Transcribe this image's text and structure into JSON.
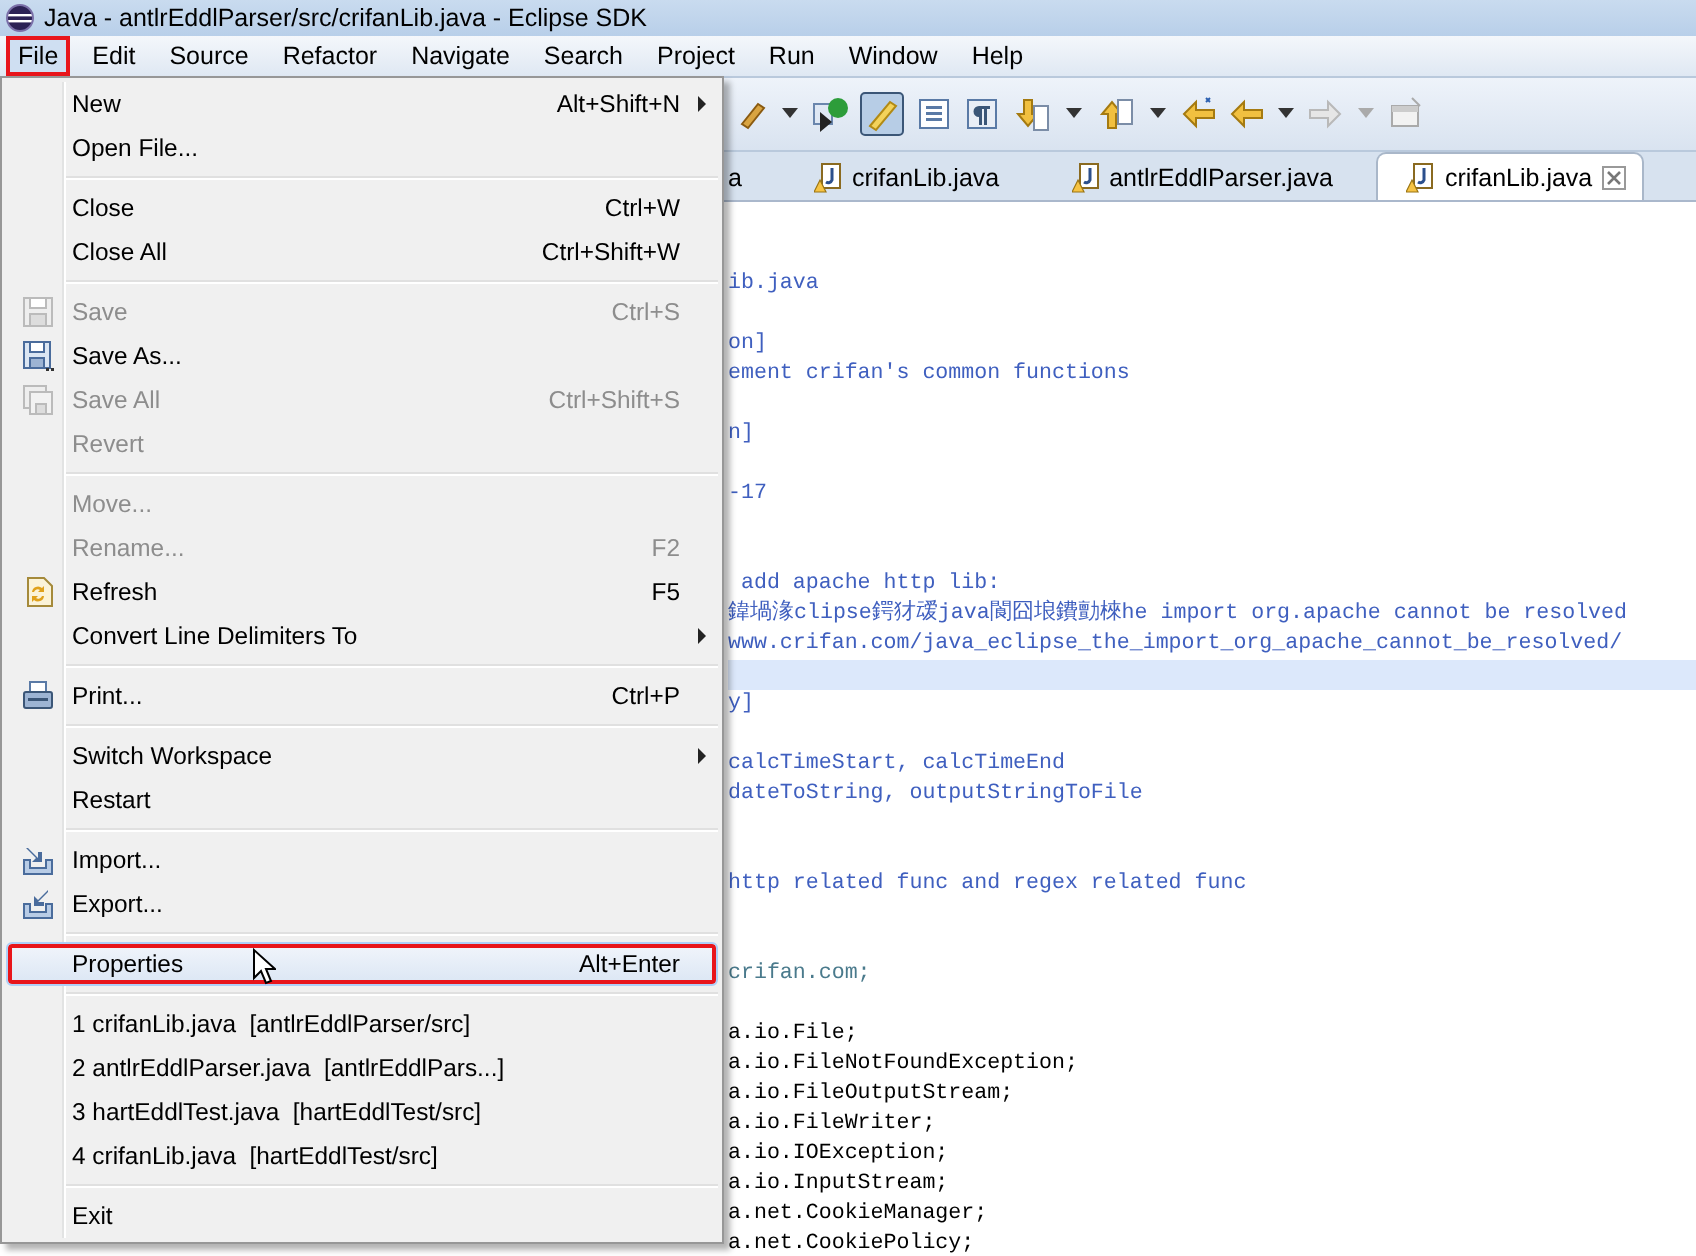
{
  "window": {
    "title": "Java - antlrEddlParser/src/crifanLib.java - Eclipse SDK"
  },
  "menubar": [
    {
      "label": "File",
      "selected": true,
      "highlighted": true
    },
    {
      "label": "Edit",
      "selected": false,
      "highlighted": false
    },
    {
      "label": "Source",
      "selected": false,
      "highlighted": false
    },
    {
      "label": "Refactor",
      "selected": false,
      "highlighted": false
    },
    {
      "label": "Navigate",
      "selected": false,
      "highlighted": false
    },
    {
      "label": "Search",
      "selected": false,
      "highlighted": false
    },
    {
      "label": "Project",
      "selected": false,
      "highlighted": false
    },
    {
      "label": "Run",
      "selected": false,
      "highlighted": false
    },
    {
      "label": "Window",
      "selected": false,
      "highlighted": false
    },
    {
      "label": "Help",
      "selected": false,
      "highlighted": false
    }
  ],
  "tabs": [
    {
      "label": "a",
      "selected": false,
      "warning": false,
      "closable": false
    },
    {
      "label": "crifanLib.java",
      "selected": false,
      "warning": true,
      "closable": false
    },
    {
      "label": "antlrEddlParser.java",
      "selected": false,
      "warning": true,
      "closable": false
    },
    {
      "label": "crifanLib.java",
      "selected": true,
      "warning": true,
      "closable": true
    }
  ],
  "editor": {
    "lines": [
      {
        "kind": "comment",
        "current": false
      },
      {
        "text": "ib.java",
        "kind": "comment",
        "current": false
      },
      {
        "kind": "comment",
        "current": false
      },
      {
        "text": "on]",
        "kind": "comment",
        "current": false
      },
      {
        "text": "ement crifan's common functions",
        "kind": "comment",
        "current": false
      },
      {
        "kind": "comment",
        "current": false
      },
      {
        "text": "n]",
        "kind": "comment",
        "current": false
      },
      {
        "kind": "comment",
        "current": false
      },
      {
        "text": "-17",
        "kind": "comment",
        "current": false
      },
      {
        "kind": "comment",
        "current": false
      },
      {
        "kind": "comment",
        "current": false
      },
      {
        "text": " add apache http lib:",
        "kind": "comment",
        "current": false
      },
      {
        "text": "鍏堝湪clipse鍔犲叆java閬囧埌鐨勯棶he import org.apache cannot be resolved",
        "kind": "comment",
        "current": false
      },
      {
        "text": "www.crifan.com/java_eclipse_the_import_org_apache_cannot_be_resolved/",
        "kind": "comment",
        "current": false
      },
      {
        "kind": "comment",
        "current": true
      },
      {
        "text": "y]",
        "kind": "comment",
        "current": false
      },
      {
        "kind": "comment",
        "current": false
      },
      {
        "text": "calcTimeStart, calcTimeEnd",
        "kind": "comment",
        "current": false
      },
      {
        "text": "dateToString, outputStringToFile",
        "kind": "comment",
        "current": false
      },
      {
        "kind": "comment",
        "current": false
      },
      {
        "kind": "comment",
        "current": false
      },
      {
        "text": "http related func and regex related func",
        "kind": "comment",
        "current": false
      },
      {
        "kind": "comment",
        "current": false
      },
      {
        "kind": "comment",
        "current": false
      },
      {
        "text": "crifan.com;",
        "kind": "package",
        "current": false
      },
      {
        "kind": "code",
        "current": false
      },
      {
        "text": "a.io.File;",
        "kind": "code",
        "current": false
      },
      {
        "text": "a.io.FileNotFoundException;",
        "kind": "code",
        "current": false
      },
      {
        "text": "a.io.FileOutputStream;",
        "kind": "code",
        "current": false
      },
      {
        "text": "a.io.FileWriter;",
        "kind": "code",
        "current": false
      },
      {
        "text": "a.io.IOException;",
        "kind": "code",
        "current": false
      },
      {
        "text": "a.io.InputStream;",
        "kind": "code",
        "current": false
      },
      {
        "text": "a.net.CookieManager;",
        "kind": "code",
        "current": false
      },
      {
        "text": "a.net.CookiePolicy;",
        "kind": "code",
        "current": false
      }
    ]
  },
  "file_menu": {
    "items": [
      {
        "kind": "item",
        "label": "New",
        "shortcut": "Alt+Shift+N",
        "submenu": true,
        "disabled": false,
        "selected": false,
        "highlighted": false
      },
      {
        "kind": "item",
        "label": "Open File...",
        "submenu": false,
        "disabled": false,
        "selected": false,
        "highlighted": false
      },
      {
        "kind": "separator"
      },
      {
        "kind": "item",
        "label": "Close",
        "shortcut": "Ctrl+W",
        "submenu": false,
        "disabled": false,
        "selected": false,
        "highlighted": false
      },
      {
        "kind": "item",
        "label": "Close All",
        "shortcut": "Ctrl+Shift+W",
        "submenu": false,
        "disabled": false,
        "selected": false,
        "highlighted": false
      },
      {
        "kind": "separator"
      },
      {
        "kind": "item",
        "label": "Save",
        "shortcut": "Ctrl+S",
        "submenu": false,
        "disabled": true,
        "selected": false,
        "highlighted": false
      },
      {
        "kind": "item",
        "label": "Save As...",
        "submenu": false,
        "disabled": false,
        "selected": false,
        "highlighted": false
      },
      {
        "kind": "item",
        "label": "Save All",
        "shortcut": "Ctrl+Shift+S",
        "submenu": false,
        "disabled": true,
        "selected": false,
        "highlighted": false
      },
      {
        "kind": "item",
        "label": "Revert",
        "submenu": false,
        "disabled": true,
        "selected": false,
        "highlighted": false
      },
      {
        "kind": "separator"
      },
      {
        "kind": "item",
        "label": "Move...",
        "submenu": false,
        "disabled": true,
        "selected": false,
        "highlighted": false
      },
      {
        "kind": "item",
        "label": "Rename...",
        "shortcut": "F2",
        "submenu": false,
        "disabled": true,
        "selected": false,
        "highlighted": false
      },
      {
        "kind": "item",
        "label": "Refresh",
        "shortcut": "F5",
        "submenu": false,
        "disabled": false,
        "selected": false,
        "highlighted": false
      },
      {
        "kind": "item",
        "label": "Convert Line Delimiters To",
        "submenu": true,
        "disabled": false,
        "selected": false,
        "highlighted": false
      },
      {
        "kind": "separator"
      },
      {
        "kind": "item",
        "label": "Print...",
        "shortcut": "Ctrl+P",
        "submenu": false,
        "disabled": false,
        "selected": false,
        "highlighted": false
      },
      {
        "kind": "separator"
      },
      {
        "kind": "item",
        "label": "Switch Workspace",
        "submenu": true,
        "disabled": false,
        "selected": false,
        "highlighted": false
      },
      {
        "kind": "item",
        "label": "Restart",
        "submenu": false,
        "disabled": false,
        "selected": false,
        "highlighted": false
      },
      {
        "kind": "separator"
      },
      {
        "kind": "item",
        "label": "Import...",
        "submenu": false,
        "disabled": false,
        "selected": false,
        "highlighted": false
      },
      {
        "kind": "item",
        "label": "Export...",
        "submenu": false,
        "disabled": false,
        "selected": false,
        "highlighted": false
      },
      {
        "kind": "separator"
      },
      {
        "kind": "item",
        "label": "Properties",
        "shortcut": "Alt+Enter",
        "submenu": false,
        "disabled": false,
        "selected": true,
        "highlighted": true
      },
      {
        "kind": "separator"
      },
      {
        "kind": "item",
        "label": "1 crifanLib.java  [antlrEddlParser/src]",
        "submenu": false,
        "disabled": false,
        "selected": false,
        "highlighted": false
      },
      {
        "kind": "item",
        "label": "2 antlrEddlParser.java  [antlrEddlPars...]",
        "submenu": false,
        "disabled": false,
        "selected": false,
        "highlighted": false
      },
      {
        "kind": "item",
        "label": "3 hartEddlTest.java  [hartEddlTest/src]",
        "submenu": false,
        "disabled": false,
        "selected": false,
        "highlighted": false
      },
      {
        "kind": "item",
        "label": "4 crifanLib.java  [hartEddlTest/src]",
        "submenu": false,
        "disabled": false,
        "selected": false,
        "highlighted": false
      },
      {
        "kind": "separator"
      },
      {
        "kind": "item",
        "label": "Exit",
        "submenu": false,
        "disabled": false,
        "selected": false,
        "highlighted": false
      }
    ]
  }
}
